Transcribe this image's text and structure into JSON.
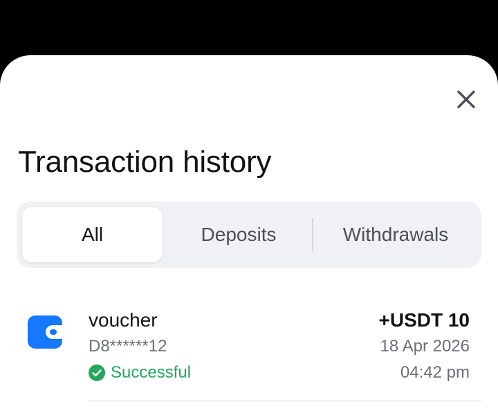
{
  "sheet": {
    "close_icon": "close-icon",
    "title": "Transaction history"
  },
  "tabs": [
    {
      "label": "All",
      "active": true
    },
    {
      "label": "Deposits",
      "active": false
    },
    {
      "label": "Withdrawals",
      "active": false
    }
  ],
  "transactions": [
    {
      "icon": "wallet-icon",
      "name": "voucher",
      "reference": "D8******12",
      "status": "Successful",
      "status_icon": "check-circle-icon",
      "amount": "+USDT 10",
      "date": "18 Apr 2026",
      "time": "04:42 pm"
    }
  ],
  "colors": {
    "background_overlay": "#000000",
    "sheet": "#ffffff",
    "tab_track": "#eff1f4",
    "accent_blue": "#1677ff",
    "success_green": "#21a85a",
    "text_primary": "#121212",
    "text_secondary": "#6b6f76"
  }
}
